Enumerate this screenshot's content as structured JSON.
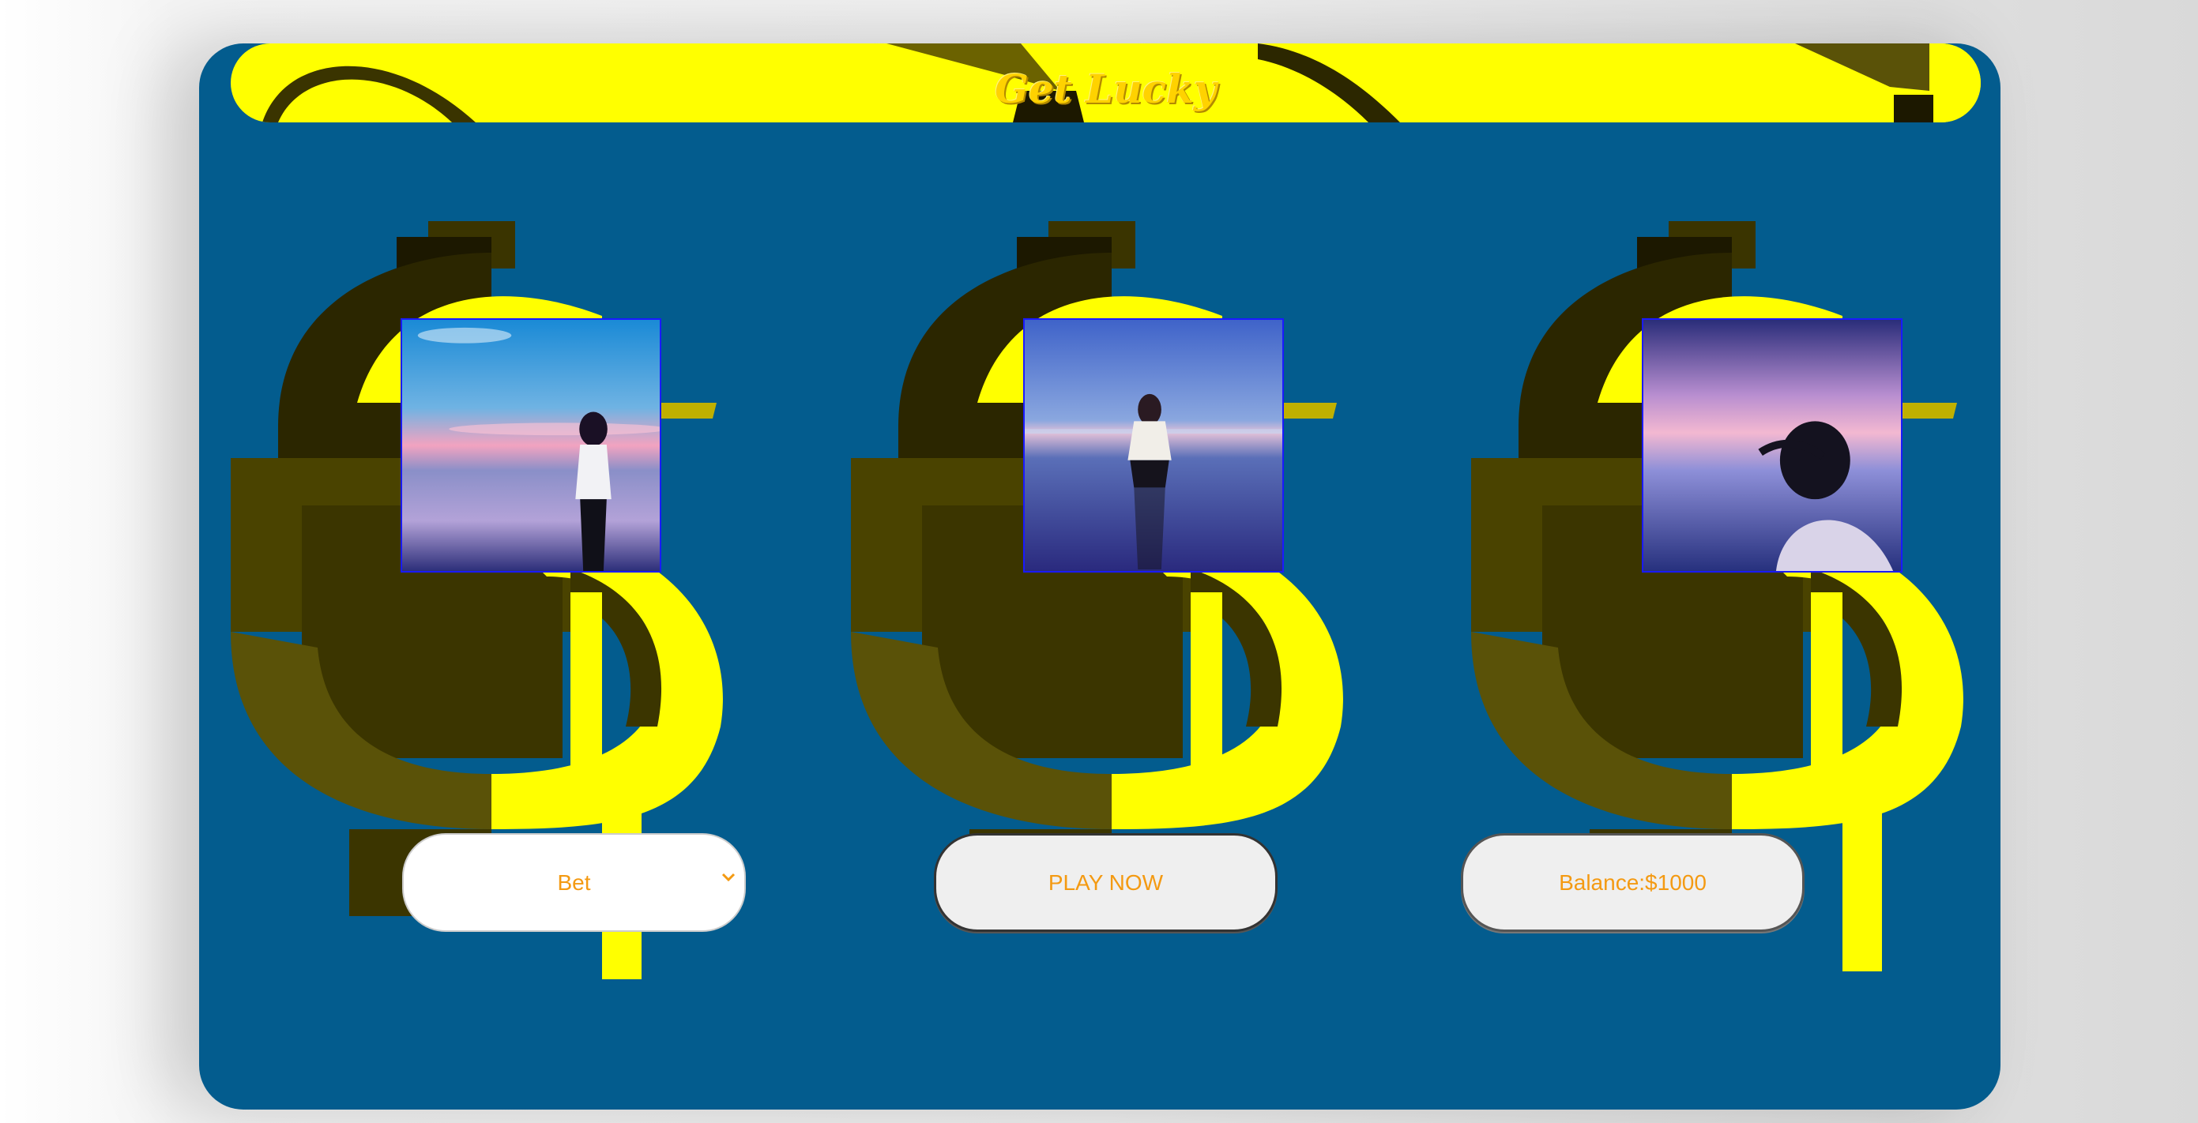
{
  "header": {
    "title": "Get Lucky"
  },
  "controls": {
    "bet_label": "Bet",
    "play_label": "PLAY NOW",
    "balance_label": "Balance:$1000"
  },
  "reels": [
    {
      "image": "woman-on-beach-at-sunset"
    },
    {
      "image": "woman-crouching-on-reflective-beach"
    },
    {
      "image": "windblown-hair-under-purple-sky"
    }
  ],
  "colors": {
    "machine_bg": "#035c8e",
    "banner": "#ffff00",
    "title": "#ffd200",
    "control_text": "#f49a12",
    "dollar_yellow": "#ffff00",
    "dollar_dark": "#5a5208"
  }
}
